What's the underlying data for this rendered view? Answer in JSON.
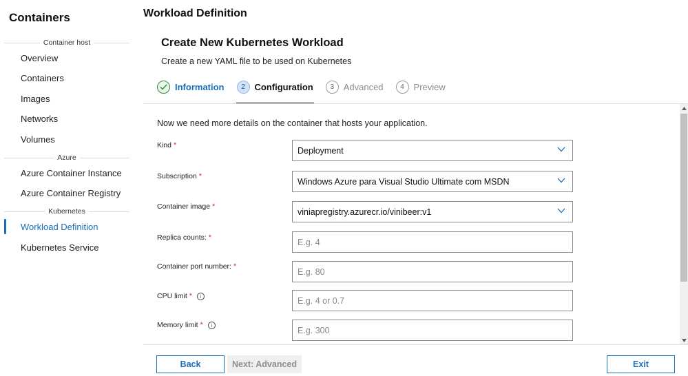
{
  "sidebar": {
    "title": "Containers",
    "groups": [
      {
        "header": "Container host",
        "items": [
          "Overview",
          "Containers",
          "Images",
          "Networks",
          "Volumes"
        ]
      },
      {
        "header": "Azure",
        "items": [
          "Azure Container Instance",
          "Azure Container Registry"
        ]
      },
      {
        "header": "Kubernetes",
        "items": [
          "Workload Definition",
          "Kubernetes Service"
        ]
      }
    ],
    "active_item": "Workload Definition"
  },
  "page_title": "Workload Definition",
  "wizard": {
    "title": "Create New Kubernetes Workload",
    "subtitle": "Create a new YAML file to be used on Kubernetes",
    "steps": [
      {
        "number": "",
        "label": "Information",
        "state": "done"
      },
      {
        "number": "2",
        "label": "Configuration",
        "state": "current"
      },
      {
        "number": "3",
        "label": "Advanced",
        "state": "future"
      },
      {
        "number": "4",
        "label": "Preview",
        "state": "future"
      }
    ]
  },
  "form": {
    "intro": "Now we need more details on the container that hosts your application.",
    "required_marker": "*",
    "info_glyph": "i",
    "fields": {
      "kind": {
        "label": "Kind",
        "value": "Deployment"
      },
      "subscription": {
        "label": "Subscription",
        "value": "Windows Azure para Visual Studio Ultimate com MSDN"
      },
      "container_image": {
        "label": "Container image",
        "value": "viniapregistry.azurecr.io/vinibeer:v1"
      },
      "replica_counts": {
        "label": "Replica counts:",
        "placeholder": "E.g. 4",
        "value": ""
      },
      "container_port": {
        "label": "Container port number:",
        "placeholder": "E.g. 80",
        "value": ""
      },
      "cpu_limit": {
        "label": "CPU limit",
        "placeholder": "E.g. 4 or 0.7",
        "value": ""
      },
      "memory_limit": {
        "label": "Memory limit",
        "placeholder": "E.g. 300",
        "value": ""
      }
    }
  },
  "footer": {
    "back_label": "Back",
    "next_label": "Next: Advanced",
    "exit_label": "Exit"
  },
  "colors": {
    "accent": "#1a6fb8",
    "required": "#d13438",
    "done_check": "#2e8b3b"
  },
  "icons": {
    "done_step": "checkmark-icon",
    "dropdown": "chevron-down-icon",
    "info": "info-icon"
  }
}
